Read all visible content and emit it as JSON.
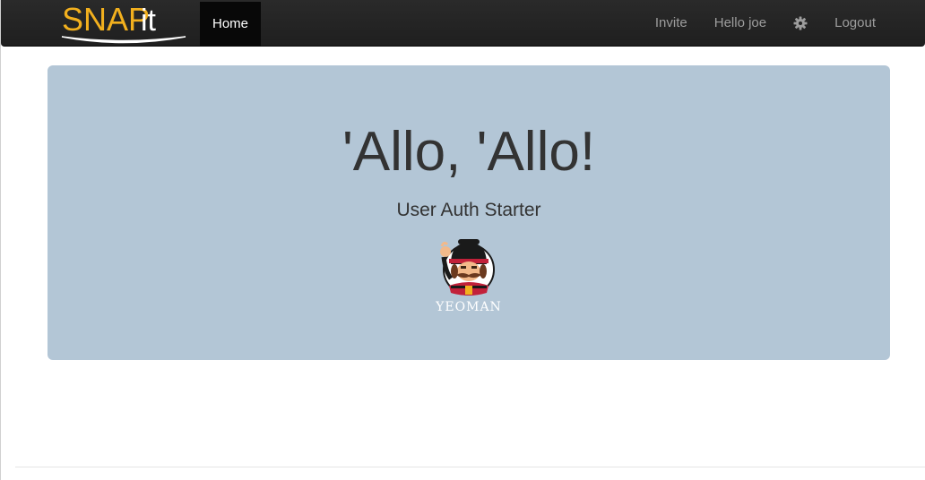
{
  "navbar": {
    "brand": {
      "prefix": "SNAP",
      "suffix": "it"
    },
    "home_label": "Home",
    "invite_label": "Invite",
    "greeting_label": "Hello joe",
    "settings_icon": "gear-icon",
    "logout_label": "Logout"
  },
  "jumbotron": {
    "title": "'Allo, 'Allo!",
    "subtitle": "User Auth Starter",
    "image_label": "YEOMAN"
  },
  "colors": {
    "navbar_bg": "#222222",
    "brand_yellow": "#f2b01e",
    "jumbotron_bg": "#b3c6d6",
    "active_tab_bg": "#080808",
    "nav_link": "#9d9d9d"
  }
}
